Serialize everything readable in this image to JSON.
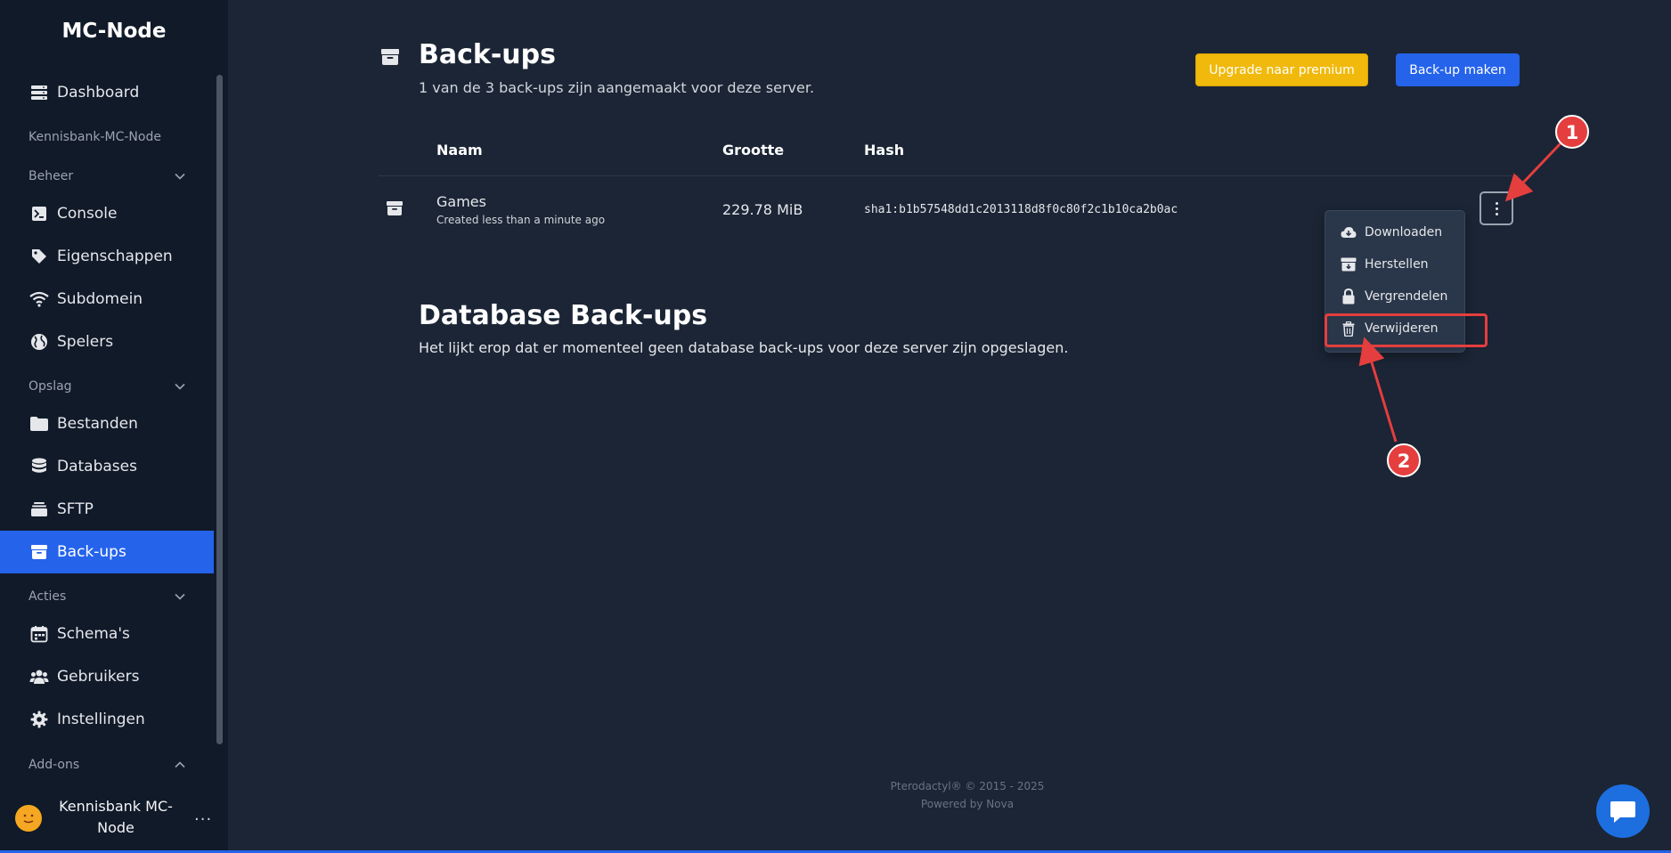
{
  "sidebar": {
    "brand": "MC-Node",
    "dashboard": "Dashboard",
    "server_name": "Kennisbank-MC-Node",
    "sections": {
      "beheer": "Beheer",
      "opslag": "Opslag",
      "acties": "Acties",
      "addons": "Add-ons"
    },
    "items": {
      "console": "Console",
      "eigenschappen": "Eigenschappen",
      "subdomein": "Subdomein",
      "spelers": "Spelers",
      "bestanden": "Bestanden",
      "databases": "Databases",
      "sftp": "SFTP",
      "backups": "Back-ups",
      "schemas": "Schema's",
      "gebruikers": "Gebruikers",
      "instellingen": "Instellingen"
    },
    "active_item": "Back-ups",
    "user": {
      "name": "Kennisbank MC-Node",
      "more": "···"
    }
  },
  "header": {
    "title": "Back-ups",
    "subtitle": "1 van de 3 back-ups zijn aangemaakt voor deze server.",
    "premium_button": "Upgrade naar premium",
    "create_button": "Back-up maken"
  },
  "table": {
    "columns": [
      "Naam",
      "Grootte",
      "Hash"
    ],
    "rows": [
      {
        "name": "Games",
        "created": "Created less than a minute ago",
        "size": "229.78 MiB",
        "hash": "sha1:b1b57548dd1c2013118d8f0c80f2c1b10ca2b0ac"
      }
    ]
  },
  "dropdown": {
    "items": [
      "Downloaden",
      "Herstellen",
      "Vergrendelen",
      "Verwijderen"
    ]
  },
  "database_section": {
    "title": "Database Back-ups",
    "text": "Het lijkt erop dat er momenteel geen database back-ups voor deze server zijn opgeslagen."
  },
  "footer": {
    "line1": "Pterodactyl® © 2015 - 2025",
    "line2": "Powered by Nova"
  },
  "annotations": {
    "marker1": "1",
    "marker2": "2"
  },
  "colors": {
    "accent": "#2563eb",
    "premium": "#f0b90b",
    "annotation": "#e53e3e",
    "background": "#1b2535",
    "sidebar": "#111a29"
  }
}
